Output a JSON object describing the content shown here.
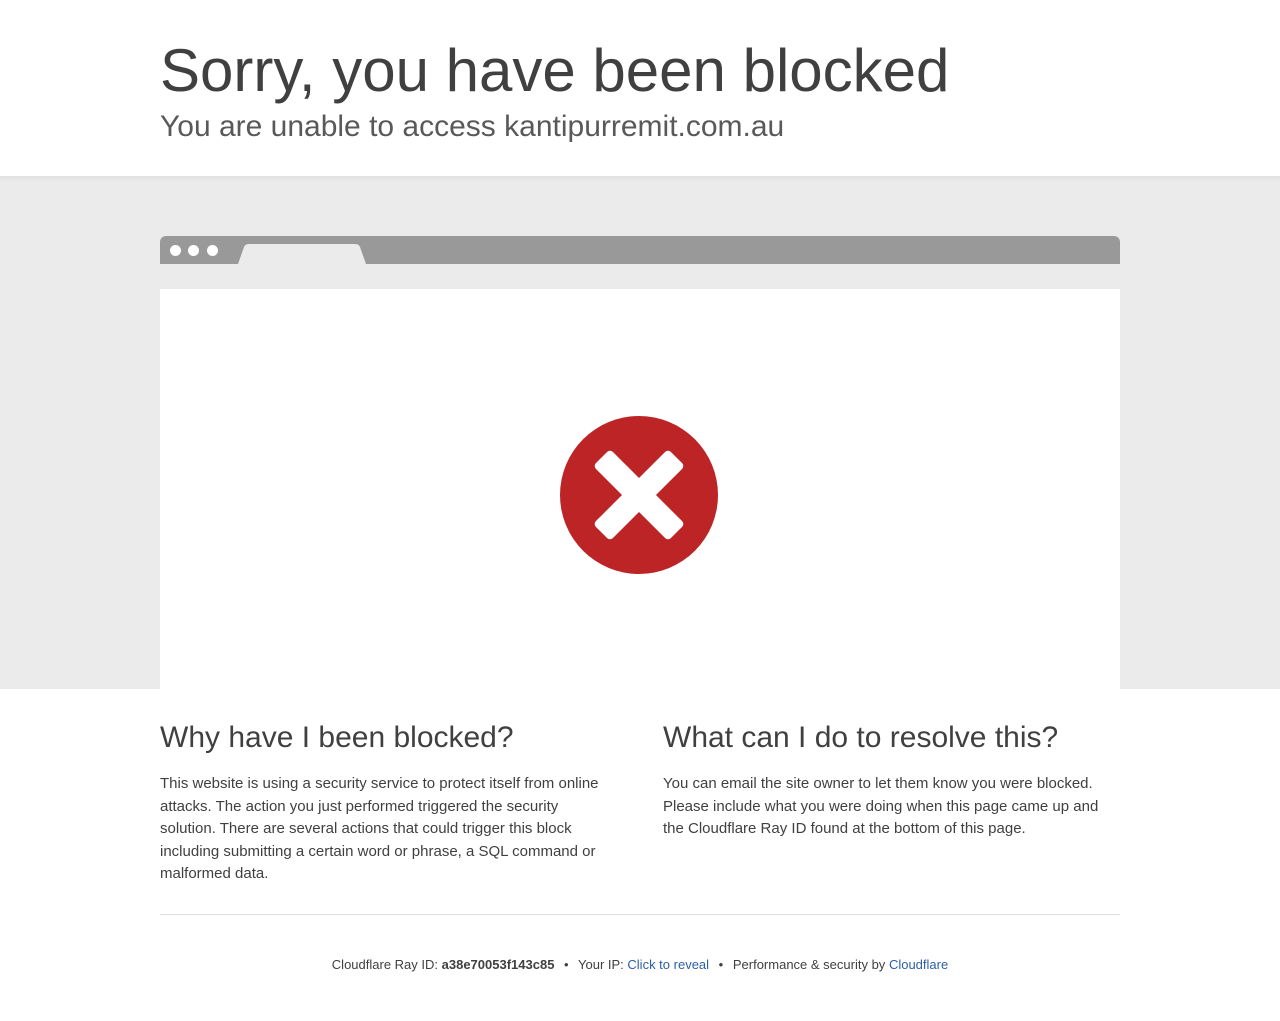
{
  "header": {
    "title": "Sorry, you have been blocked",
    "subtitle": "You are unable to access kantipurremit.com.au"
  },
  "illustration": {
    "icon": "blocked-x-icon",
    "accent_color": "#bd2426",
    "bar_color": "#999999",
    "stage_color": "#ebebeb"
  },
  "why": {
    "heading": "Why have I been blocked?",
    "body": "This website is using a security service to protect itself from online attacks. The action you just performed triggered the security solution. There are several actions that could trigger this block including submitting a certain word or phrase, a SQL command or malformed data."
  },
  "resolve": {
    "heading": "What can I do to resolve this?",
    "body": "You can email the site owner to let them know you were blocked. Please include what you were doing when this page came up and the Cloudflare Ray ID found at the bottom of this page."
  },
  "footer": {
    "ray_label": "Cloudflare Ray ID:",
    "ray_id": "a38e70053f143c85",
    "separator": "•",
    "ip_label": "Your IP:",
    "ip_link": "Click to reveal",
    "perf_label": "Performance & security by",
    "perf_link": "Cloudflare",
    "link_color": "#2c5faa"
  }
}
